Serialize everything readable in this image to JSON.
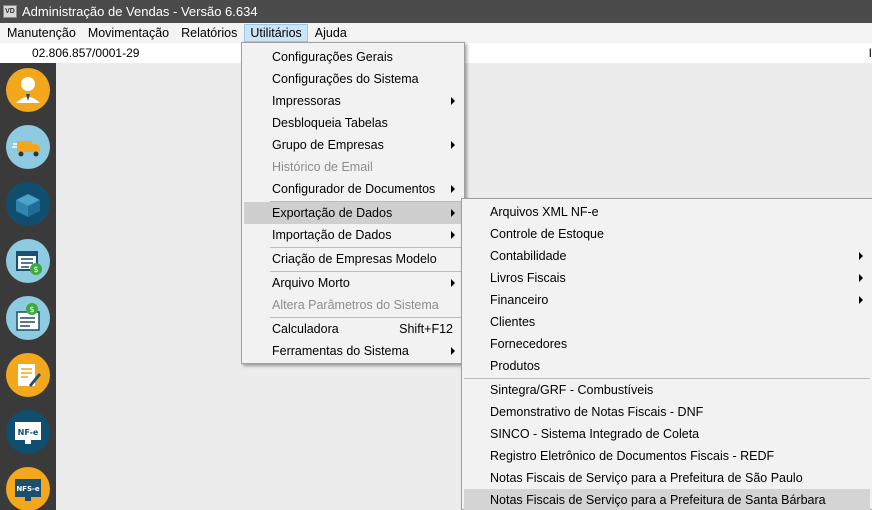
{
  "window": {
    "title": "Administração de Vendas - Versão 6.634",
    "app_icon_text": "VD"
  },
  "menubar": [
    "Manutenção",
    "Movimentação",
    "Relatórios",
    "Utilitários",
    "Ajuda"
  ],
  "company": {
    "cnpj": "02.806.857/0001-29",
    "edge_char": "I"
  },
  "sidebar": [
    {
      "name": "user-icon",
      "color": "#f2a71c"
    },
    {
      "name": "delivery-truck-icon",
      "color": "#8ecae0"
    },
    {
      "name": "package-box-icon",
      "color": "#0f4e6e"
    },
    {
      "name": "calendar-money-icon",
      "color": "#8ecae0"
    },
    {
      "name": "invoice-money-icon",
      "color": "#8ecae0"
    },
    {
      "name": "document-edit-icon",
      "color": "#f2a71c"
    },
    {
      "name": "nfe-icon",
      "label": "NF-e",
      "color": "#0f4e6e"
    },
    {
      "name": "nfse-icon",
      "label": "NFS-e",
      "color": "#f2a71c"
    }
  ],
  "utilitarios_menu": {
    "items": [
      {
        "label": "Configurações Gerais"
      },
      {
        "label": "Configurações do Sistema"
      },
      {
        "label": "Impressoras",
        "submenu": true
      },
      {
        "label": "Desbloqueia Tabelas"
      },
      {
        "label": "Grupo de Empresas",
        "submenu": true
      },
      {
        "label": "Histórico de Email",
        "disabled": true
      },
      {
        "label": "Configurador de Documentos",
        "submenu": true
      },
      {
        "label": "Exportação de Dados",
        "submenu": true,
        "highlighted": true
      },
      {
        "label": "Importação de Dados",
        "submenu": true
      },
      {
        "label": "Criação de Empresas Modelo"
      },
      {
        "label": "Arquivo Morto",
        "submenu": true
      },
      {
        "label": "Altera Parâmetros do Sistema",
        "disabled": true
      },
      {
        "label": "Calculadora",
        "shortcut": "Shift+F12"
      },
      {
        "label": "Ferramentas do Sistema",
        "submenu": true
      }
    ]
  },
  "exportacao_menu": {
    "items": [
      {
        "label": "Arquivos XML NF-e"
      },
      {
        "label": "Controle de Estoque"
      },
      {
        "label": "Contabilidade",
        "submenu": true
      },
      {
        "label": "Livros Fiscais",
        "submenu": true
      },
      {
        "label": "Financeiro",
        "submenu": true
      },
      {
        "label": "Clientes"
      },
      {
        "label": "Fornecedores"
      },
      {
        "label": "Produtos"
      },
      {
        "label": "Sintegra/GRF - Combustíveis"
      },
      {
        "label": "Demonstrativo de Notas Fiscais - DNF"
      },
      {
        "label": "SINCO - Sistema Integrado de Coleta"
      },
      {
        "label": "Registro Eletrônico de Documentos Fiscais - REDF"
      },
      {
        "label": "Notas Fiscais de Serviço para a Prefeitura de São Paulo"
      },
      {
        "label": "Notas Fiscais de Serviço para a Prefeitura de Santa Bárbara D'Oeste",
        "highlighted": true
      }
    ]
  }
}
